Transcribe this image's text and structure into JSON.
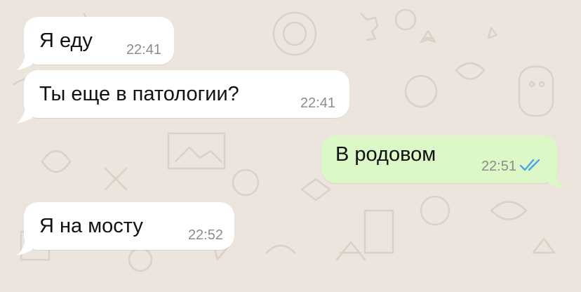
{
  "chat": {
    "messages": [
      {
        "direction": "incoming",
        "text": "Я еду",
        "time": "22:41"
      },
      {
        "direction": "incoming",
        "text": "Ты еще в патологии?",
        "time": "22:41"
      },
      {
        "direction": "outgoing",
        "text": "В родовом",
        "time": "22:51",
        "status": "read"
      },
      {
        "direction": "incoming",
        "text": "Я на мосту",
        "time": "22:52"
      }
    ]
  },
  "colors": {
    "background": "#ece5dd",
    "incoming_bubble": "#ffffff",
    "outgoing_bubble": "#dcf8c6",
    "read_ticks": "#4fa3e6",
    "time_text": "#8c8c8c"
  },
  "icons": {
    "read_status": "double-check-icon"
  }
}
